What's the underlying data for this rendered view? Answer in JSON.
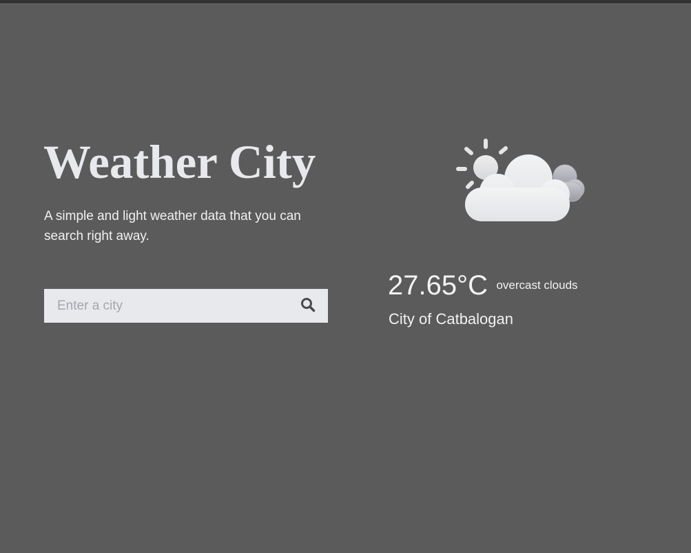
{
  "header": {
    "title": "Weather City",
    "tagline": "A simple and light weather data that you can search right away."
  },
  "search": {
    "placeholder": "Enter a city",
    "value": "",
    "button_icon": "search-icon"
  },
  "weather": {
    "icon": "partly-cloudy-icon",
    "temperature": "27.65°C",
    "description": "overcast clouds",
    "city": "City of Catbalogan"
  },
  "colors": {
    "background": "#5b5b5b",
    "title": "#e8e9ec",
    "search_box": "#e8e9ec",
    "search_icon": "#4a4a4a"
  }
}
